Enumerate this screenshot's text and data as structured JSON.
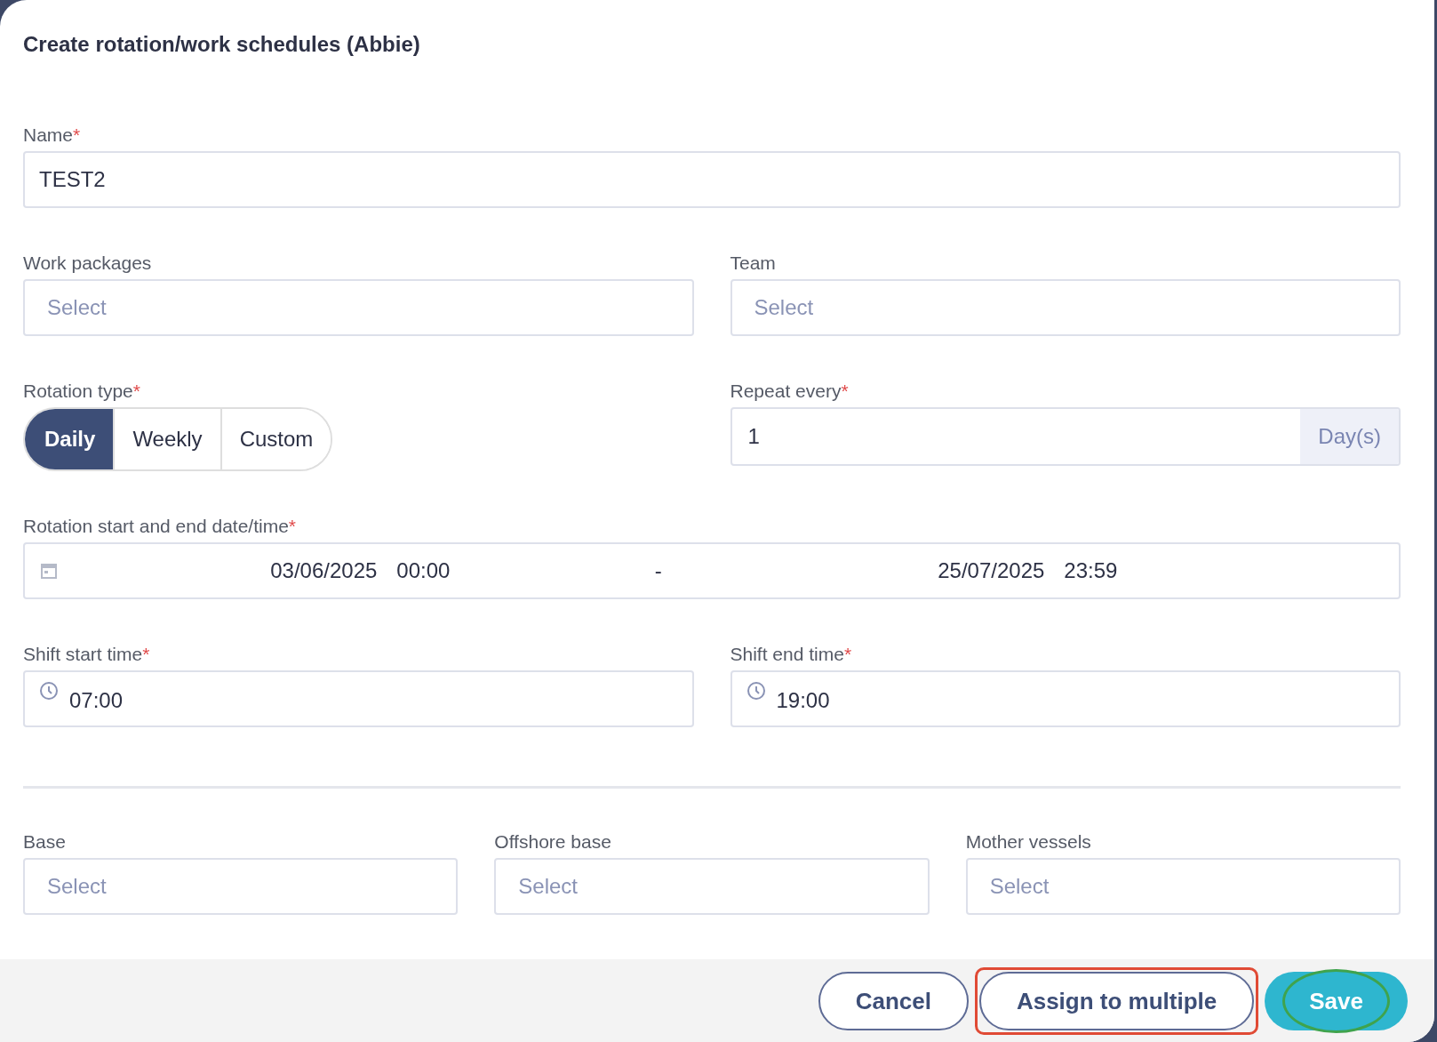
{
  "title": "Create rotation/work schedules (Abbie)",
  "name": {
    "label": "Name",
    "required_mark": "*",
    "value": "TEST2"
  },
  "work_packages": {
    "label": "Work packages",
    "placeholder": "Select"
  },
  "team": {
    "label": "Team",
    "placeholder": "Select"
  },
  "rotation_type": {
    "label": "Rotation type",
    "required_mark": "*",
    "options": [
      {
        "label": "Daily",
        "selected": true
      },
      {
        "label": "Weekly",
        "selected": false
      },
      {
        "label": "Custom",
        "selected": false
      }
    ]
  },
  "repeat_every": {
    "label": "Repeat every",
    "required_mark": "*",
    "value": "1",
    "unit": "Day(s)"
  },
  "rotation_dates": {
    "label": "Rotation start and end date/time",
    "required_mark": "*",
    "start_date": "03/06/2025",
    "start_time": "00:00",
    "separator": "-",
    "end_date": "25/07/2025",
    "end_time": "23:59"
  },
  "shift_start": {
    "label": "Shift start time",
    "required_mark": "*",
    "value": "07:00"
  },
  "shift_end": {
    "label": "Shift end time",
    "required_mark": "*",
    "value": "19:00"
  },
  "base": {
    "label": "Base",
    "placeholder": "Select"
  },
  "offshore_base": {
    "label": "Offshore base",
    "placeholder": "Select"
  },
  "mother_vessels": {
    "label": "Mother vessels",
    "placeholder": "Select"
  },
  "buttons": [
    {
      "label": "Cancel",
      "kind": "outline"
    },
    {
      "label": "Assign to multiple",
      "kind": "outline",
      "highlight": {
        "kind": "rect",
        "color": "#e04a35"
      }
    },
    {
      "label": "Save",
      "kind": "primary",
      "highlight": {
        "kind": "oval",
        "color": "#3fa34d"
      }
    }
  ]
}
